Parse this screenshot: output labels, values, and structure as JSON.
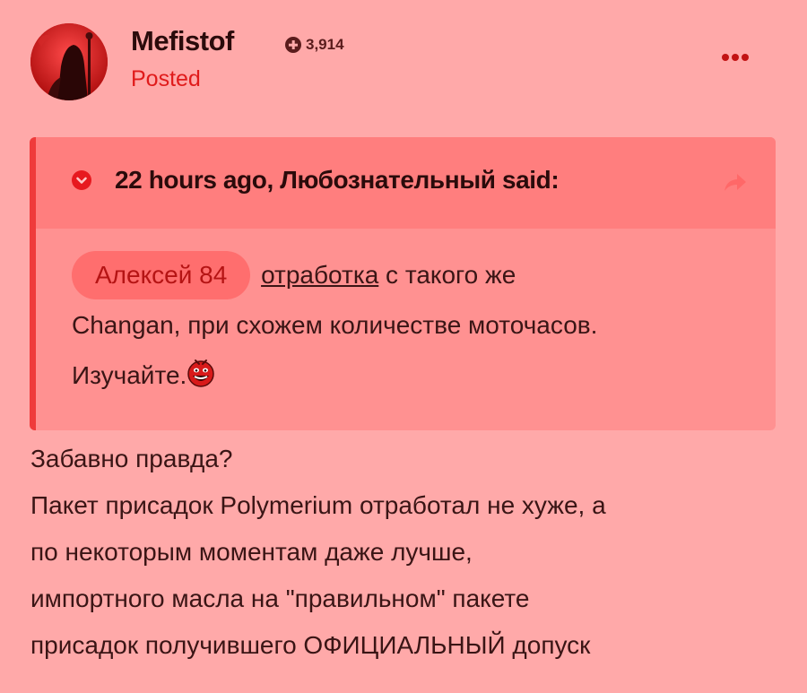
{
  "author": {
    "name": "Mefistof",
    "reputation": "3,914",
    "status": "Posted"
  },
  "quote": {
    "citation": "22 hours ago, Любознательный said:",
    "mention": "Алексей 84",
    "link_text": "отработка",
    "text_after_link": " с такого же",
    "line2": "Changan, при схожем количестве моточасов.",
    "line3": "Изучайте."
  },
  "post": {
    "lines": [
      "Забавно правда?",
      "Пакет присадок Polymerium отработал не хуже, а",
      "по некоторым моментам даже лучше,",
      "импортного масла на \"правильном\" пакете",
      "присадок получившего ОФИЦИАЛЬНЫЙ допуск"
    ]
  },
  "icons": {
    "avatar": "hooded-figure-avatar",
    "reputation": "plus-circle-icon",
    "more": "ellipsis-icon",
    "quote_toggle": "chevron-down-circle-icon",
    "quote_share": "share-arrow-icon",
    "smiley": "laughing-smiley-icon"
  },
  "colors": {
    "background": "#ffa9a9",
    "accent": "#e01b1b",
    "quote_header": "#ff7e7e",
    "mention_bg": "#ff6e6e"
  }
}
